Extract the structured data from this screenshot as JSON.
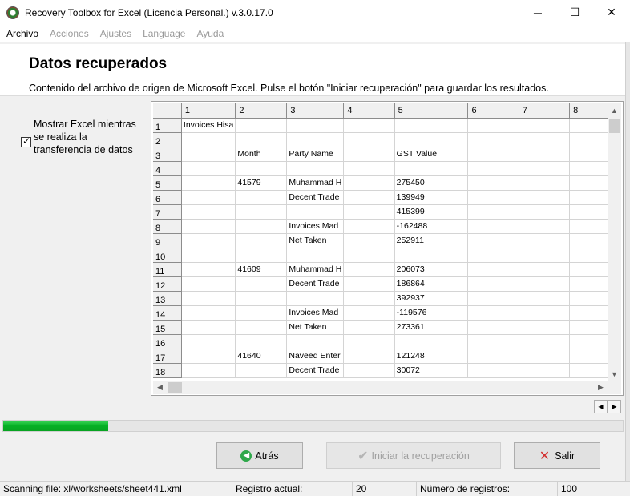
{
  "window": {
    "title": "Recovery Toolbox for Excel (Licencia Personal.) v.3.0.17.0",
    "minimize": "─",
    "maximize": "☐",
    "close": "✕"
  },
  "menu": [
    "Archivo",
    "Acciones",
    "Ajustes",
    "Language",
    "Ayuda"
  ],
  "header": {
    "title": "Datos recuperados",
    "subtitle": "Contenido del archivo de origen de Microsoft Excel. Pulse el botón \"Iniciar recuperación\" para guardar los resultados."
  },
  "options": {
    "show_excel_label": "Mostrar Excel mientras se realiza la transferencia de datos",
    "show_excel_checked": true
  },
  "grid": {
    "columns": [
      "1",
      "2",
      "3",
      "4",
      "5",
      "6",
      "7",
      "8"
    ],
    "rows": [
      {
        "n": "1",
        "cells": [
          "Invoices Hisa",
          "",
          "",
          "",
          "",
          "",
          "",
          ""
        ]
      },
      {
        "n": "2",
        "cells": [
          "",
          "",
          "",
          "",
          "",
          "",
          "",
          ""
        ]
      },
      {
        "n": "3",
        "cells": [
          "",
          "Month",
          "Party Name",
          "",
          "GST Value",
          "",
          "",
          ""
        ]
      },
      {
        "n": "4",
        "cells": [
          "",
          "",
          "",
          "",
          "",
          "",
          "",
          ""
        ]
      },
      {
        "n": "5",
        "cells": [
          "",
          "41579",
          "Muhammad H",
          "",
          "275450",
          "",
          "",
          ""
        ]
      },
      {
        "n": "6",
        "cells": [
          "",
          "",
          "Decent Trade",
          "",
          "139949",
          "",
          "",
          ""
        ]
      },
      {
        "n": "7",
        "cells": [
          "",
          "",
          "",
          "",
          "415399",
          "",
          "",
          ""
        ]
      },
      {
        "n": "8",
        "cells": [
          "",
          "",
          "Invoices Mad",
          "",
          "-162488",
          "",
          "",
          ""
        ]
      },
      {
        "n": "9",
        "cells": [
          "",
          "",
          "Net Taken",
          "",
          "252911",
          "",
          "",
          ""
        ]
      },
      {
        "n": "10",
        "cells": [
          "",
          "",
          "",
          "",
          "",
          "",
          "",
          ""
        ]
      },
      {
        "n": "11",
        "cells": [
          "",
          "41609",
          "Muhammad H",
          "",
          "206073",
          "",
          "",
          ""
        ]
      },
      {
        "n": "12",
        "cells": [
          "",
          "",
          "Decent Trade",
          "",
          "186864",
          "",
          "",
          ""
        ]
      },
      {
        "n": "13",
        "cells": [
          "",
          "",
          "",
          "",
          "392937",
          "",
          "",
          ""
        ]
      },
      {
        "n": "14",
        "cells": [
          "",
          "",
          "Invoices Mad",
          "",
          "-119576",
          "",
          "",
          ""
        ]
      },
      {
        "n": "15",
        "cells": [
          "",
          "",
          "Net Taken",
          "",
          "273361",
          "",
          "",
          ""
        ]
      },
      {
        "n": "16",
        "cells": [
          "",
          "",
          "",
          "",
          "",
          "",
          "",
          ""
        ]
      },
      {
        "n": "17",
        "cells": [
          "",
          "41640",
          "Naveed Enter",
          "",
          "121248",
          "",
          "",
          ""
        ]
      },
      {
        "n": "18",
        "cells": [
          "",
          "",
          "Decent Trade",
          "",
          "30072",
          "",
          "",
          ""
        ]
      }
    ]
  },
  "progress": {
    "fraction": 0.17
  },
  "buttons": {
    "back": "Atrás",
    "start": "Iniciar la recuperación",
    "exit": "Salir"
  },
  "status": {
    "scanning": "Scanning file: xl/worksheets/sheet441.xml",
    "current_label": "Registro actual:",
    "current_value": "20",
    "count_label": "Número de registros:",
    "count_value": "100"
  }
}
